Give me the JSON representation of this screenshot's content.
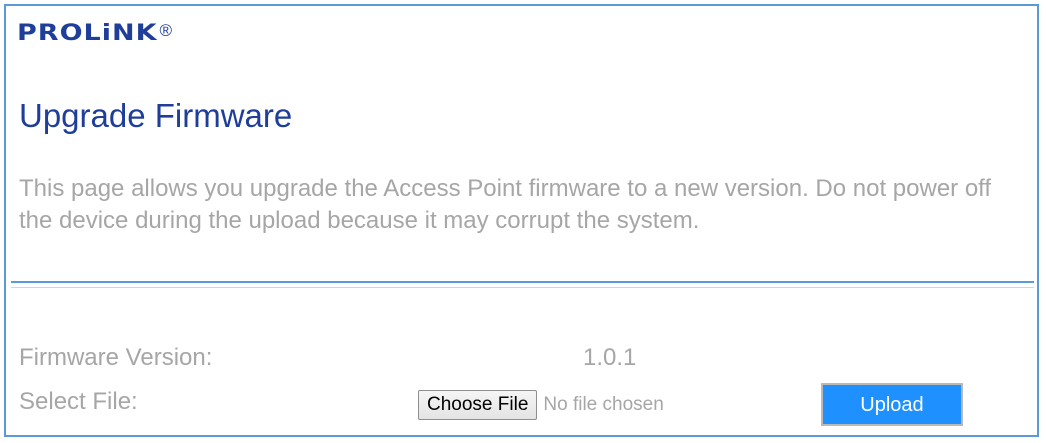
{
  "brand": {
    "name": "PROLiNK",
    "registered_mark": "®",
    "color": "#1f3e99"
  },
  "page": {
    "title": "Upgrade Firmware",
    "description": "This page allows you upgrade the Access Point firmware to a new version. Do not power off the device during the upload because it may corrupt the system."
  },
  "form": {
    "firmware_version_label": "Firmware Version:",
    "firmware_version_value": "1.0.1",
    "select_file_label": "Select File:",
    "choose_file_label": "Choose File",
    "file_status": "No file chosen",
    "upload_label": "Upload"
  },
  "colors": {
    "accent": "#5b9bd5",
    "upload_button": "#1e90ff",
    "muted_text": "#a6a6a6"
  }
}
